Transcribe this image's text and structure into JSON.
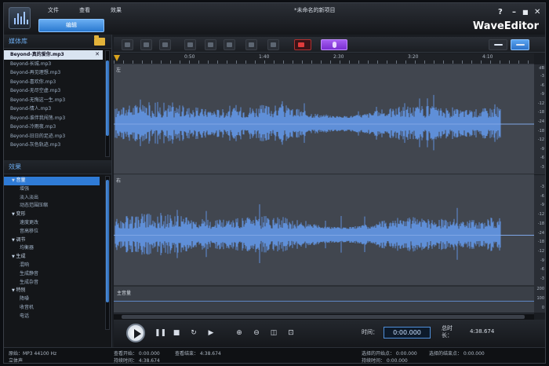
{
  "app": {
    "document_title": "*未命名的新项目",
    "brand": "WaveEditor",
    "window_controls": [
      "?",
      "–",
      "■",
      "✕"
    ]
  },
  "menu": {
    "file": "文件",
    "view": "查看",
    "effects": "效果",
    "edit_tab": "编辑"
  },
  "media_library": {
    "title": "媒体库",
    "items": [
      "Beyond-真的爱你.mp3",
      "Beyond-长城.mp3",
      "Beyond-再见理想.mp3",
      "Beyond-喜欢你.mp3",
      "Beyond-无尽空虚.mp3",
      "Beyond-无悔这一生.mp3",
      "Beyond-情人.mp3",
      "Beyond-谁伴我闯荡.mp3",
      "Beyond-冷雨夜.mp3",
      "Beyond-旧日的足迹.mp3",
      "Beyond-灰色轨迹.mp3"
    ],
    "close_label": "✕"
  },
  "effects_panel": {
    "title": "效果",
    "items": [
      {
        "label": "音量",
        "kind": "cat",
        "selected": true
      },
      {
        "label": "增强",
        "kind": "sub"
      },
      {
        "label": "淡入淡出",
        "kind": "sub"
      },
      {
        "label": "动态范围压缩",
        "kind": "sub"
      },
      {
        "label": "变形",
        "kind": "cat"
      },
      {
        "label": "速度更改",
        "kind": "sub"
      },
      {
        "label": "音高移位",
        "kind": "sub"
      },
      {
        "label": "调节",
        "kind": "cat"
      },
      {
        "label": "均衡器",
        "kind": "sub"
      },
      {
        "label": "生成",
        "kind": "cat"
      },
      {
        "label": "混响",
        "kind": "sub"
      },
      {
        "label": "生成静音",
        "kind": "sub"
      },
      {
        "label": "生成杂音",
        "kind": "sub"
      },
      {
        "label": "特别",
        "kind": "cat"
      },
      {
        "label": "降噪",
        "kind": "sub"
      },
      {
        "label": "收音机",
        "kind": "sub"
      },
      {
        "label": "电话",
        "kind": "sub"
      }
    ]
  },
  "ruler": {
    "labels": [
      "0:50",
      "1:40",
      "2:30",
      "3:20",
      "4:10"
    ]
  },
  "channels": {
    "left": "左",
    "right": "右",
    "db_unit": "dB",
    "db_ticks": [
      "-3",
      "-6",
      "-9",
      "-12",
      "-18",
      "-24",
      "-18",
      "-12",
      "-9",
      "-6",
      "-3"
    ]
  },
  "master": {
    "label": "主音量",
    "scale": [
      "200",
      "100",
      "0"
    ]
  },
  "transport": {
    "time_label": "时间：",
    "time_value": "0:00.000",
    "total_label": "总时长：",
    "total_value": "4:38.674"
  },
  "status": {
    "source": "原始：MP3  44100 Hz",
    "channel_mode": "立体声",
    "view_start": "查看开始：  0:00.000",
    "view_end": "查看结束：  4:38.674",
    "duration": "持续时间：  4:38.674",
    "sel_start": "选择的开始点：  0:00.000",
    "sel_end": "选择的结束点：  0:00.000",
    "sel_duration": "持续时间：  0:00.000"
  }
}
